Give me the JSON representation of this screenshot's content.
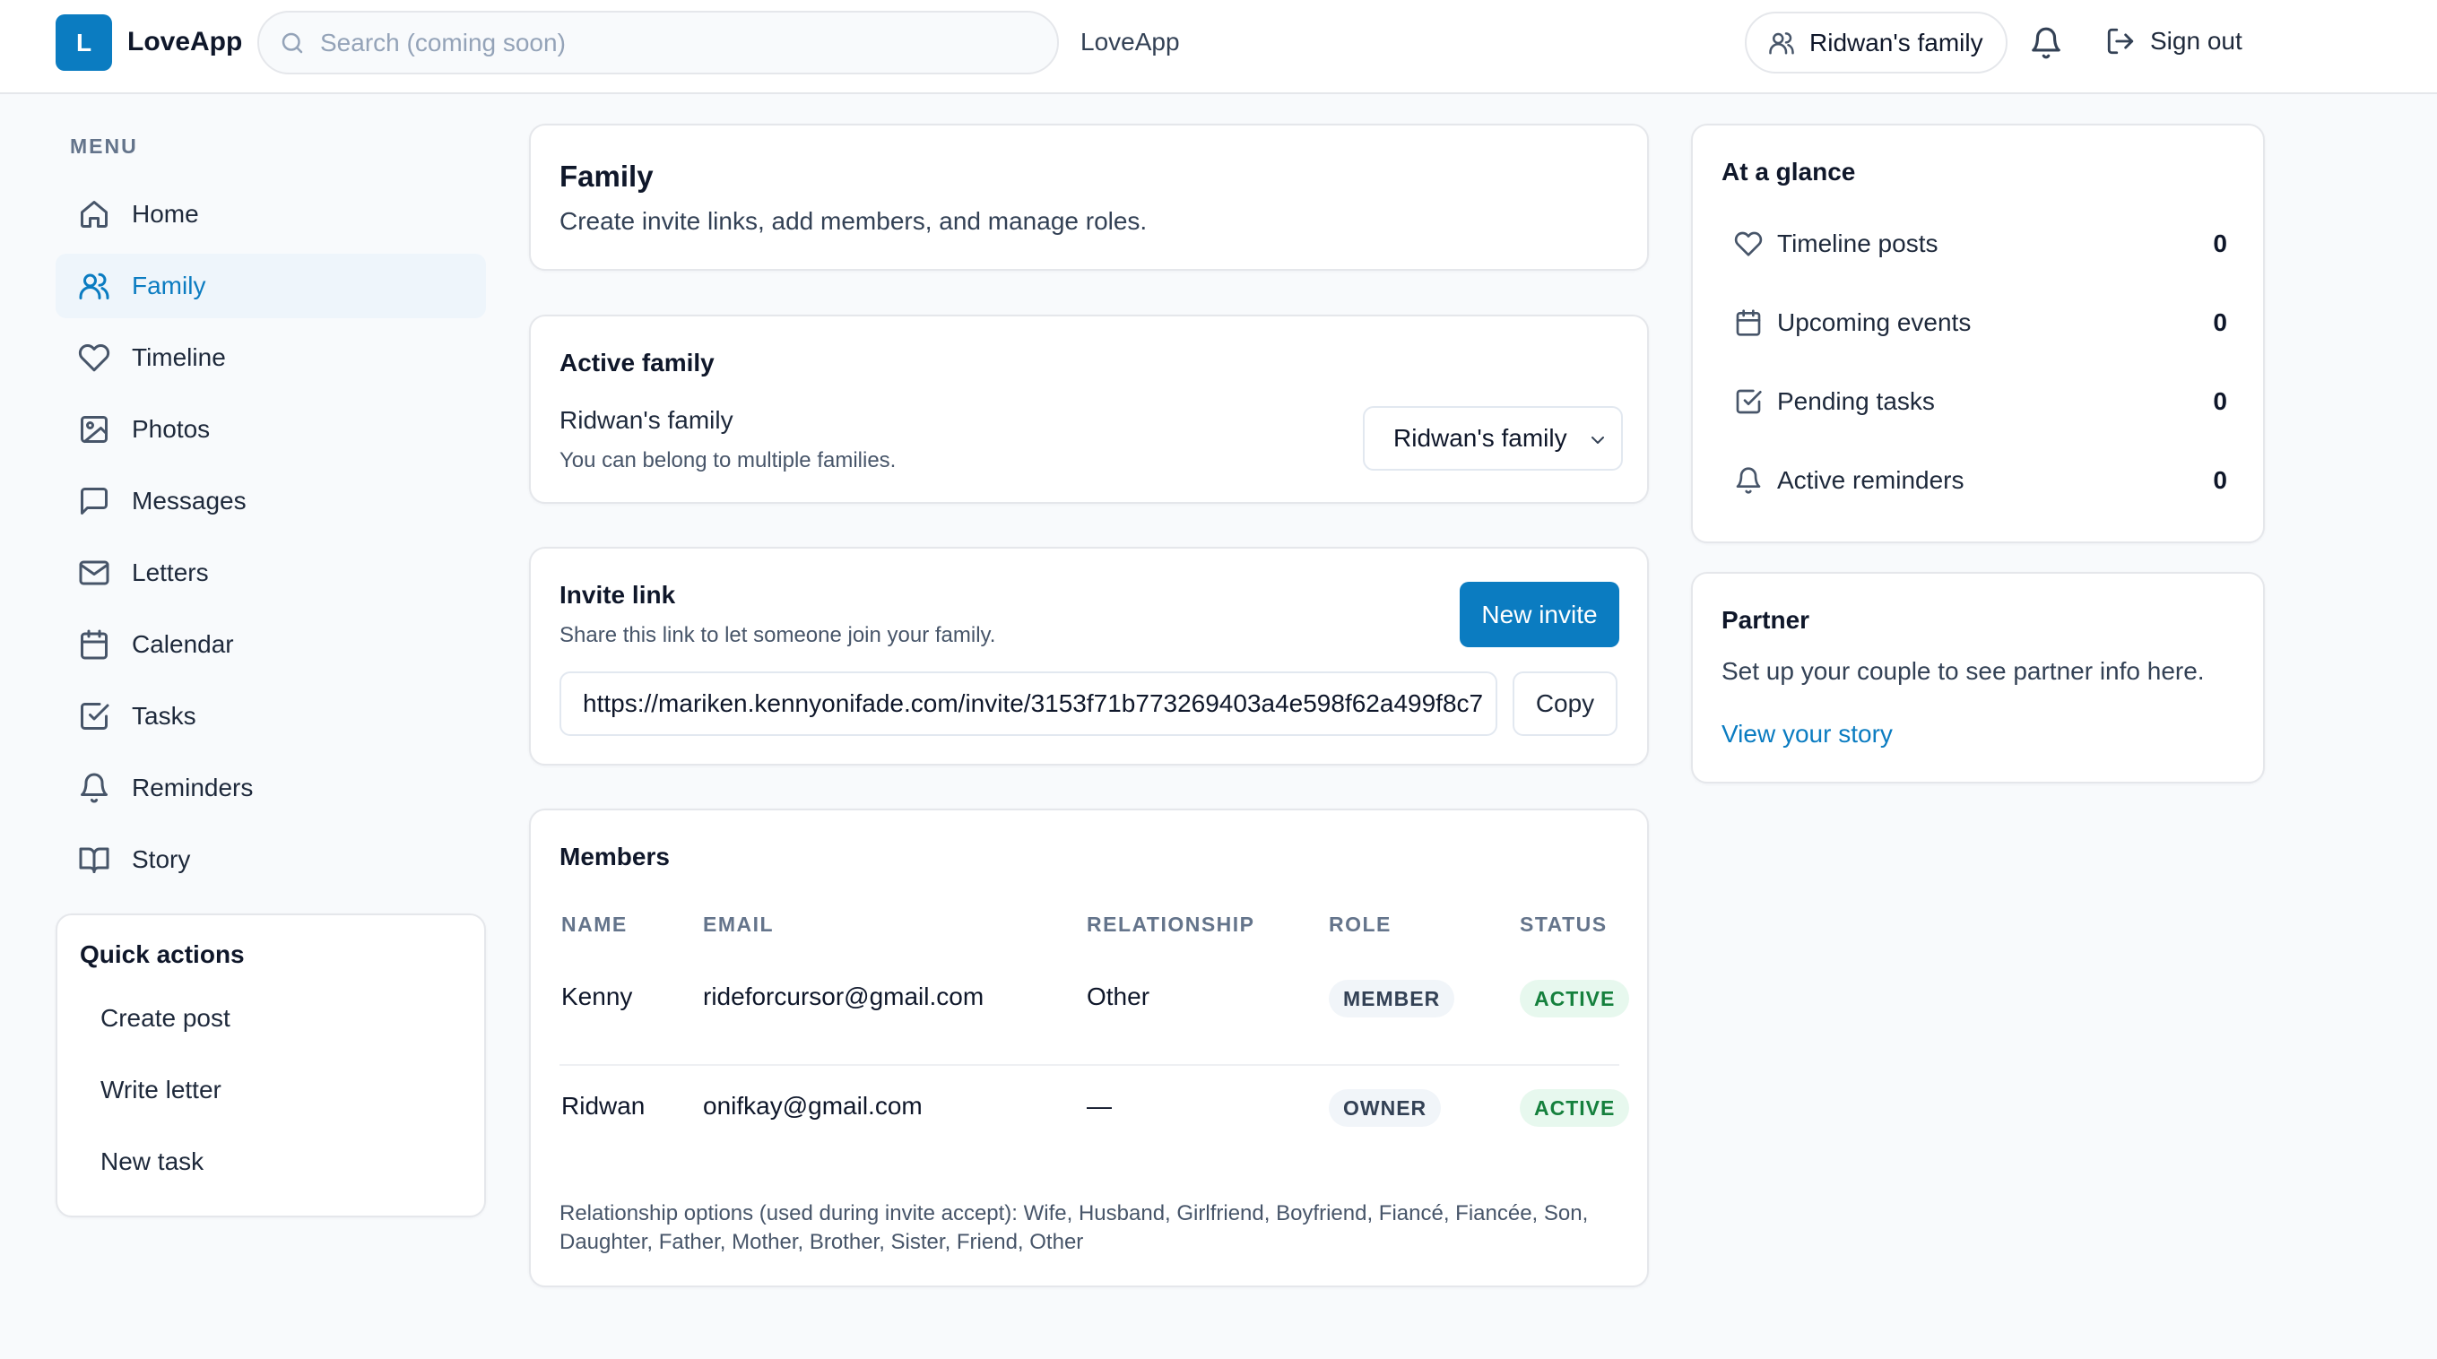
{
  "app": {
    "logo_letter": "L",
    "name": "LoveApp",
    "center_label": "LoveApp"
  },
  "search": {
    "placeholder": "Search (coming soon)"
  },
  "header": {
    "family_pill": "Ridwan's family",
    "sign_out": "Sign out"
  },
  "icons": {
    "search": "search-icon",
    "family_pill": "users-icon",
    "notifications": "bell-icon",
    "sign_out": "log-out-icon"
  },
  "colors": {
    "accent": "#0b7cc1",
    "active_bg": "#eef5fb",
    "status_active": "#15803d"
  },
  "sidebar": {
    "title": "MENU",
    "items": [
      {
        "label": "Home",
        "icon": "home-icon"
      },
      {
        "label": "Family",
        "icon": "users-icon",
        "active": true
      },
      {
        "label": "Timeline",
        "icon": "heart-icon"
      },
      {
        "label": "Photos",
        "icon": "image-icon"
      },
      {
        "label": "Messages",
        "icon": "message-square-icon"
      },
      {
        "label": "Letters",
        "icon": "mail-icon"
      },
      {
        "label": "Calendar",
        "icon": "calendar-icon"
      },
      {
        "label": "Tasks",
        "icon": "check-square-icon"
      },
      {
        "label": "Reminders",
        "icon": "bell-icon"
      },
      {
        "label": "Story",
        "icon": "book-open-icon"
      }
    ],
    "quick_actions": {
      "title": "Quick actions",
      "items": [
        "Create post",
        "Write letter",
        "New task"
      ]
    }
  },
  "family_card": {
    "title": "Family",
    "description": "Create invite links, add members, and manage roles."
  },
  "active_family": {
    "title": "Active family",
    "name": "Ridwan's family",
    "hint": "You can belong to multiple families.",
    "selected": "Ridwan's family"
  },
  "invite": {
    "title": "Invite link",
    "hint": "Share this link to let someone join your family.",
    "new_button": "New invite",
    "url": "https://mariken.kennyonifade.com/invite/3153f71b773269403a4e598f62a499f8c7",
    "copy_button": "Copy"
  },
  "members": {
    "title": "Members",
    "columns": [
      "NAME",
      "EMAIL",
      "RELATIONSHIP",
      "ROLE",
      "STATUS"
    ],
    "rows": [
      {
        "name": "Kenny",
        "email": "rideforcursor@gmail.com",
        "relationship": "Other",
        "role": "MEMBER",
        "status": "ACTIVE"
      },
      {
        "name": "Ridwan",
        "email": "onifkay@gmail.com",
        "relationship": "—",
        "role": "OWNER",
        "status": "ACTIVE"
      }
    ],
    "options_note": "Relationship options (used during invite accept): Wife, Husband, Girlfriend, Boyfriend, Fiancé, Fiancée, Son, Daughter, Father, Mother, Brother, Sister, Friend, Other"
  },
  "glance": {
    "title": "At a glance",
    "stats": [
      {
        "label": "Timeline posts",
        "value": "0",
        "icon": "heart-icon"
      },
      {
        "label": "Upcoming events",
        "value": "0",
        "icon": "calendar-icon"
      },
      {
        "label": "Pending tasks",
        "value": "0",
        "icon": "check-square-icon"
      },
      {
        "label": "Active reminders",
        "value": "0",
        "icon": "bell-icon"
      }
    ]
  },
  "partner": {
    "title": "Partner",
    "description": "Set up your couple to see partner info here.",
    "link": "View your story"
  }
}
